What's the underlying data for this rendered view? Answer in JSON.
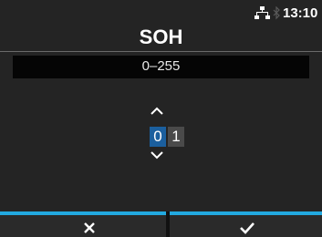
{
  "status_bar": {
    "time": "13:10",
    "icons": [
      "network-icon",
      "bluetooth-icon"
    ]
  },
  "header": {
    "title": "SOH"
  },
  "range": {
    "text": "0–255"
  },
  "editor": {
    "digits": [
      "0",
      "1"
    ],
    "selected_digit_index": 0,
    "icons": [
      "chevron-up-icon",
      "chevron-down-icon"
    ]
  },
  "softkeys": {
    "cancel_icon": "close-icon",
    "ok_icon": "checkmark-icon"
  },
  "colors": {
    "accent": "#22a9e0",
    "selected_digit": "#1b5f9e",
    "unselected_digit": "#4a4a4a",
    "background": "#242424"
  }
}
